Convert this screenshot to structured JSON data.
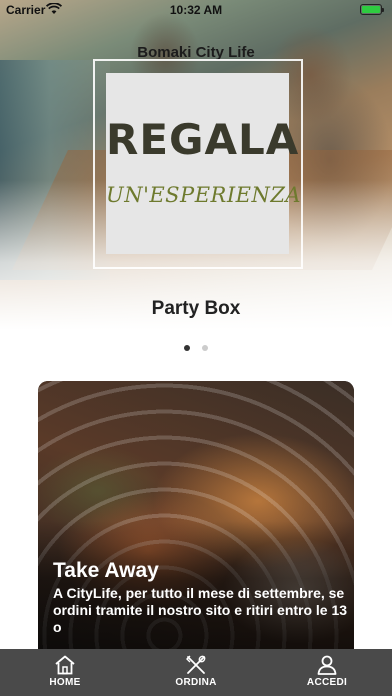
{
  "status_bar": {
    "carrier": "Carrier",
    "time": "10:32 AM",
    "wifi_icon": "wifi-icon",
    "battery_icon": "battery-icon",
    "battery_color": "#2ecc40"
  },
  "hero": {
    "restaurant_name": "Bomaki City Life",
    "promo_line1": "REGALA",
    "promo_line2": "UN'ESPERIENZA",
    "slide_title": "Party Box",
    "slides_total": 2,
    "active_slide": 1
  },
  "card": {
    "title": "Take Away",
    "text": "A CityLife, per tutto il mese di settembre, se ordini tramite il nostro sito e ritiri entro le 13 o"
  },
  "tab_bar": {
    "background": "#4a4a4a",
    "items": [
      {
        "label": "HOME",
        "icon": "home-icon"
      },
      {
        "label": "ORDINA",
        "icon": "utensils-icon"
      },
      {
        "label": "ACCEDI",
        "icon": "user-icon"
      }
    ]
  }
}
